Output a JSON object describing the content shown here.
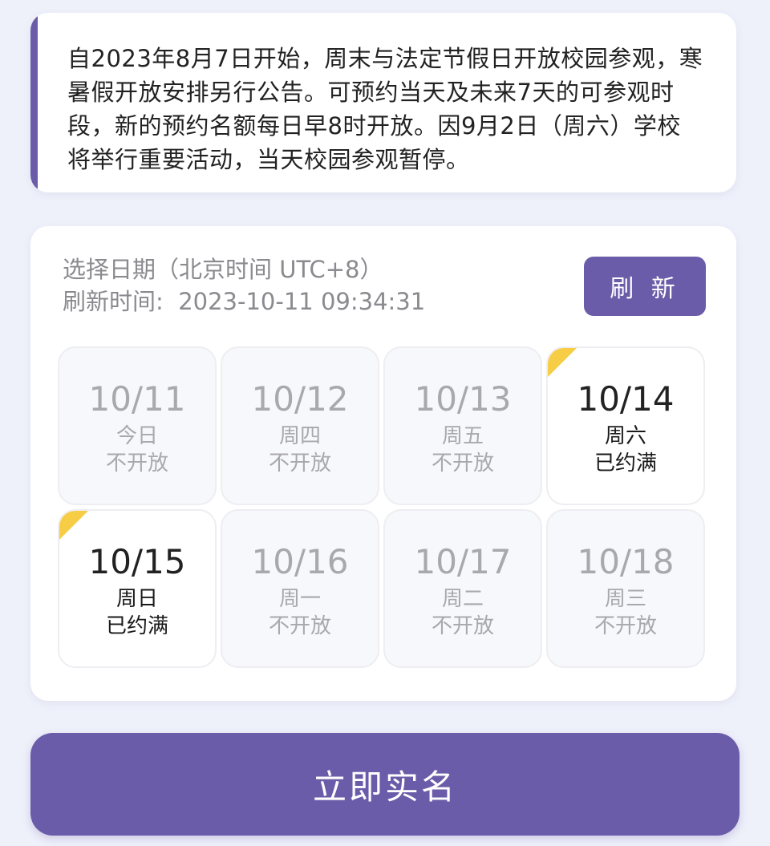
{
  "notice": {
    "text": "自2023年8月7日开始，周末与法定节假日开放校园参观，寒暑假开放安排另行公告。可预约当天及未来7天的可参观时段，新的预约名额每日早8时开放。因9月2日（周六）学校将举行重要活动，当天校园参观暂停。"
  },
  "panel": {
    "select_label": "选择日期（北京时间 UTC+8）",
    "refresh_time": "刷新时间:  2023-10-11 09:34:31",
    "refresh_button": "刷 新"
  },
  "days": [
    {
      "date": "10/11",
      "weekday": "今日",
      "status": "不开放",
      "state": "closed"
    },
    {
      "date": "10/12",
      "weekday": "周四",
      "status": "不开放",
      "state": "closed"
    },
    {
      "date": "10/13",
      "weekday": "周五",
      "status": "不开放",
      "state": "closed"
    },
    {
      "date": "10/14",
      "weekday": "周六",
      "status": "已约满",
      "state": "full"
    },
    {
      "date": "10/15",
      "weekday": "周日",
      "status": "已约满",
      "state": "full"
    },
    {
      "date": "10/16",
      "weekday": "周一",
      "status": "不开放",
      "state": "closed"
    },
    {
      "date": "10/17",
      "weekday": "周二",
      "status": "不开放",
      "state": "closed"
    },
    {
      "date": "10/18",
      "weekday": "周三",
      "status": "不开放",
      "state": "closed"
    }
  ],
  "cta": {
    "label": "立即实名"
  },
  "colors": {
    "accent": "#6a5ca9",
    "corner_tag": "#f6cd45",
    "page_bg": "#eef0fa"
  }
}
